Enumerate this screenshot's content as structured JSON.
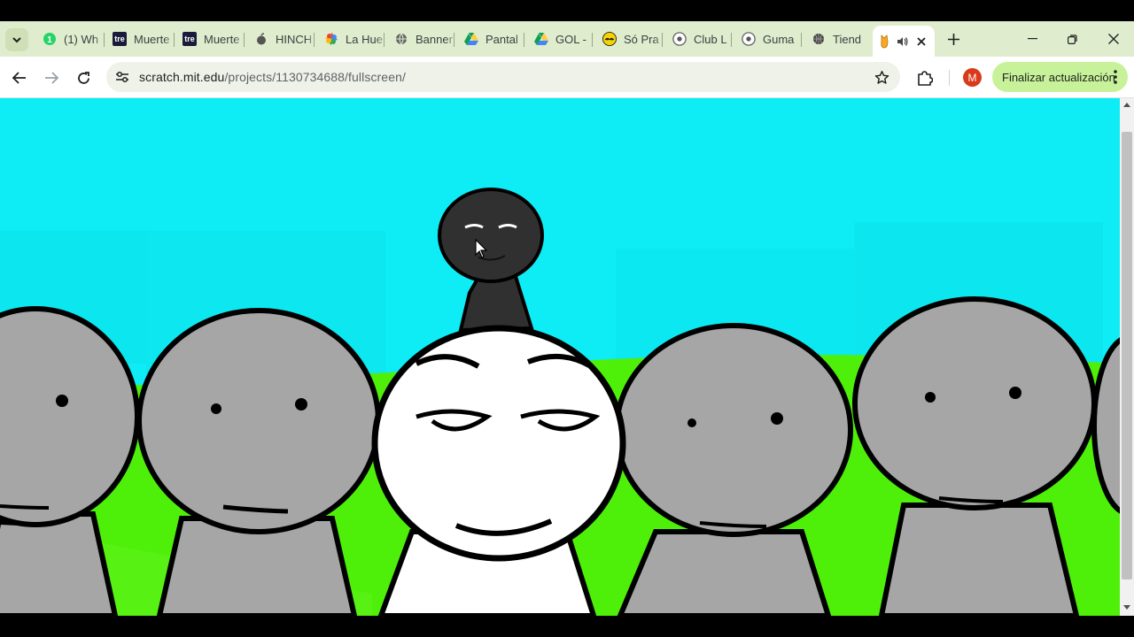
{
  "browser": {
    "tabs": [
      {
        "label": "(1) Wh",
        "icon": "whatsapp-icon"
      },
      {
        "label": "Muerte",
        "icon": "tre-icon"
      },
      {
        "label": "Muerte",
        "icon": "tre-icon"
      },
      {
        "label": "HINCH",
        "icon": "apple-icon"
      },
      {
        "label": "La Hue",
        "icon": "google-photos-icon"
      },
      {
        "label": "Banner",
        "icon": "globe-icon"
      },
      {
        "label": "Pantal",
        "icon": "google-drive-icon"
      },
      {
        "label": "GOL -",
        "icon": "google-drive-icon"
      },
      {
        "label": "Só Pra",
        "icon": "mustache-icon"
      },
      {
        "label": "Club L",
        "icon": "soccer-icon"
      },
      {
        "label": "Guma",
        "icon": "soccer-icon"
      },
      {
        "label": "Tiend",
        "icon": "basketball-icon"
      }
    ],
    "tre_badge": "tre",
    "active_tab_icon": "scratch-cat-icon",
    "address": {
      "host": "scratch.mit.edu",
      "path": "/projects/1130734688/fullscreen/"
    },
    "avatar_letter": "M",
    "update_button_label": "Finalizar actualización"
  },
  "colors": {
    "tabbar": "#dfeccd",
    "sky": "#0eecf5",
    "grass": "#4ef00a",
    "character_gray": "#a6a6a6",
    "main_character": "#ffffff",
    "shadow_character": "#303030",
    "update_button": "#c7f29a",
    "avatar": "#d93a1c"
  }
}
